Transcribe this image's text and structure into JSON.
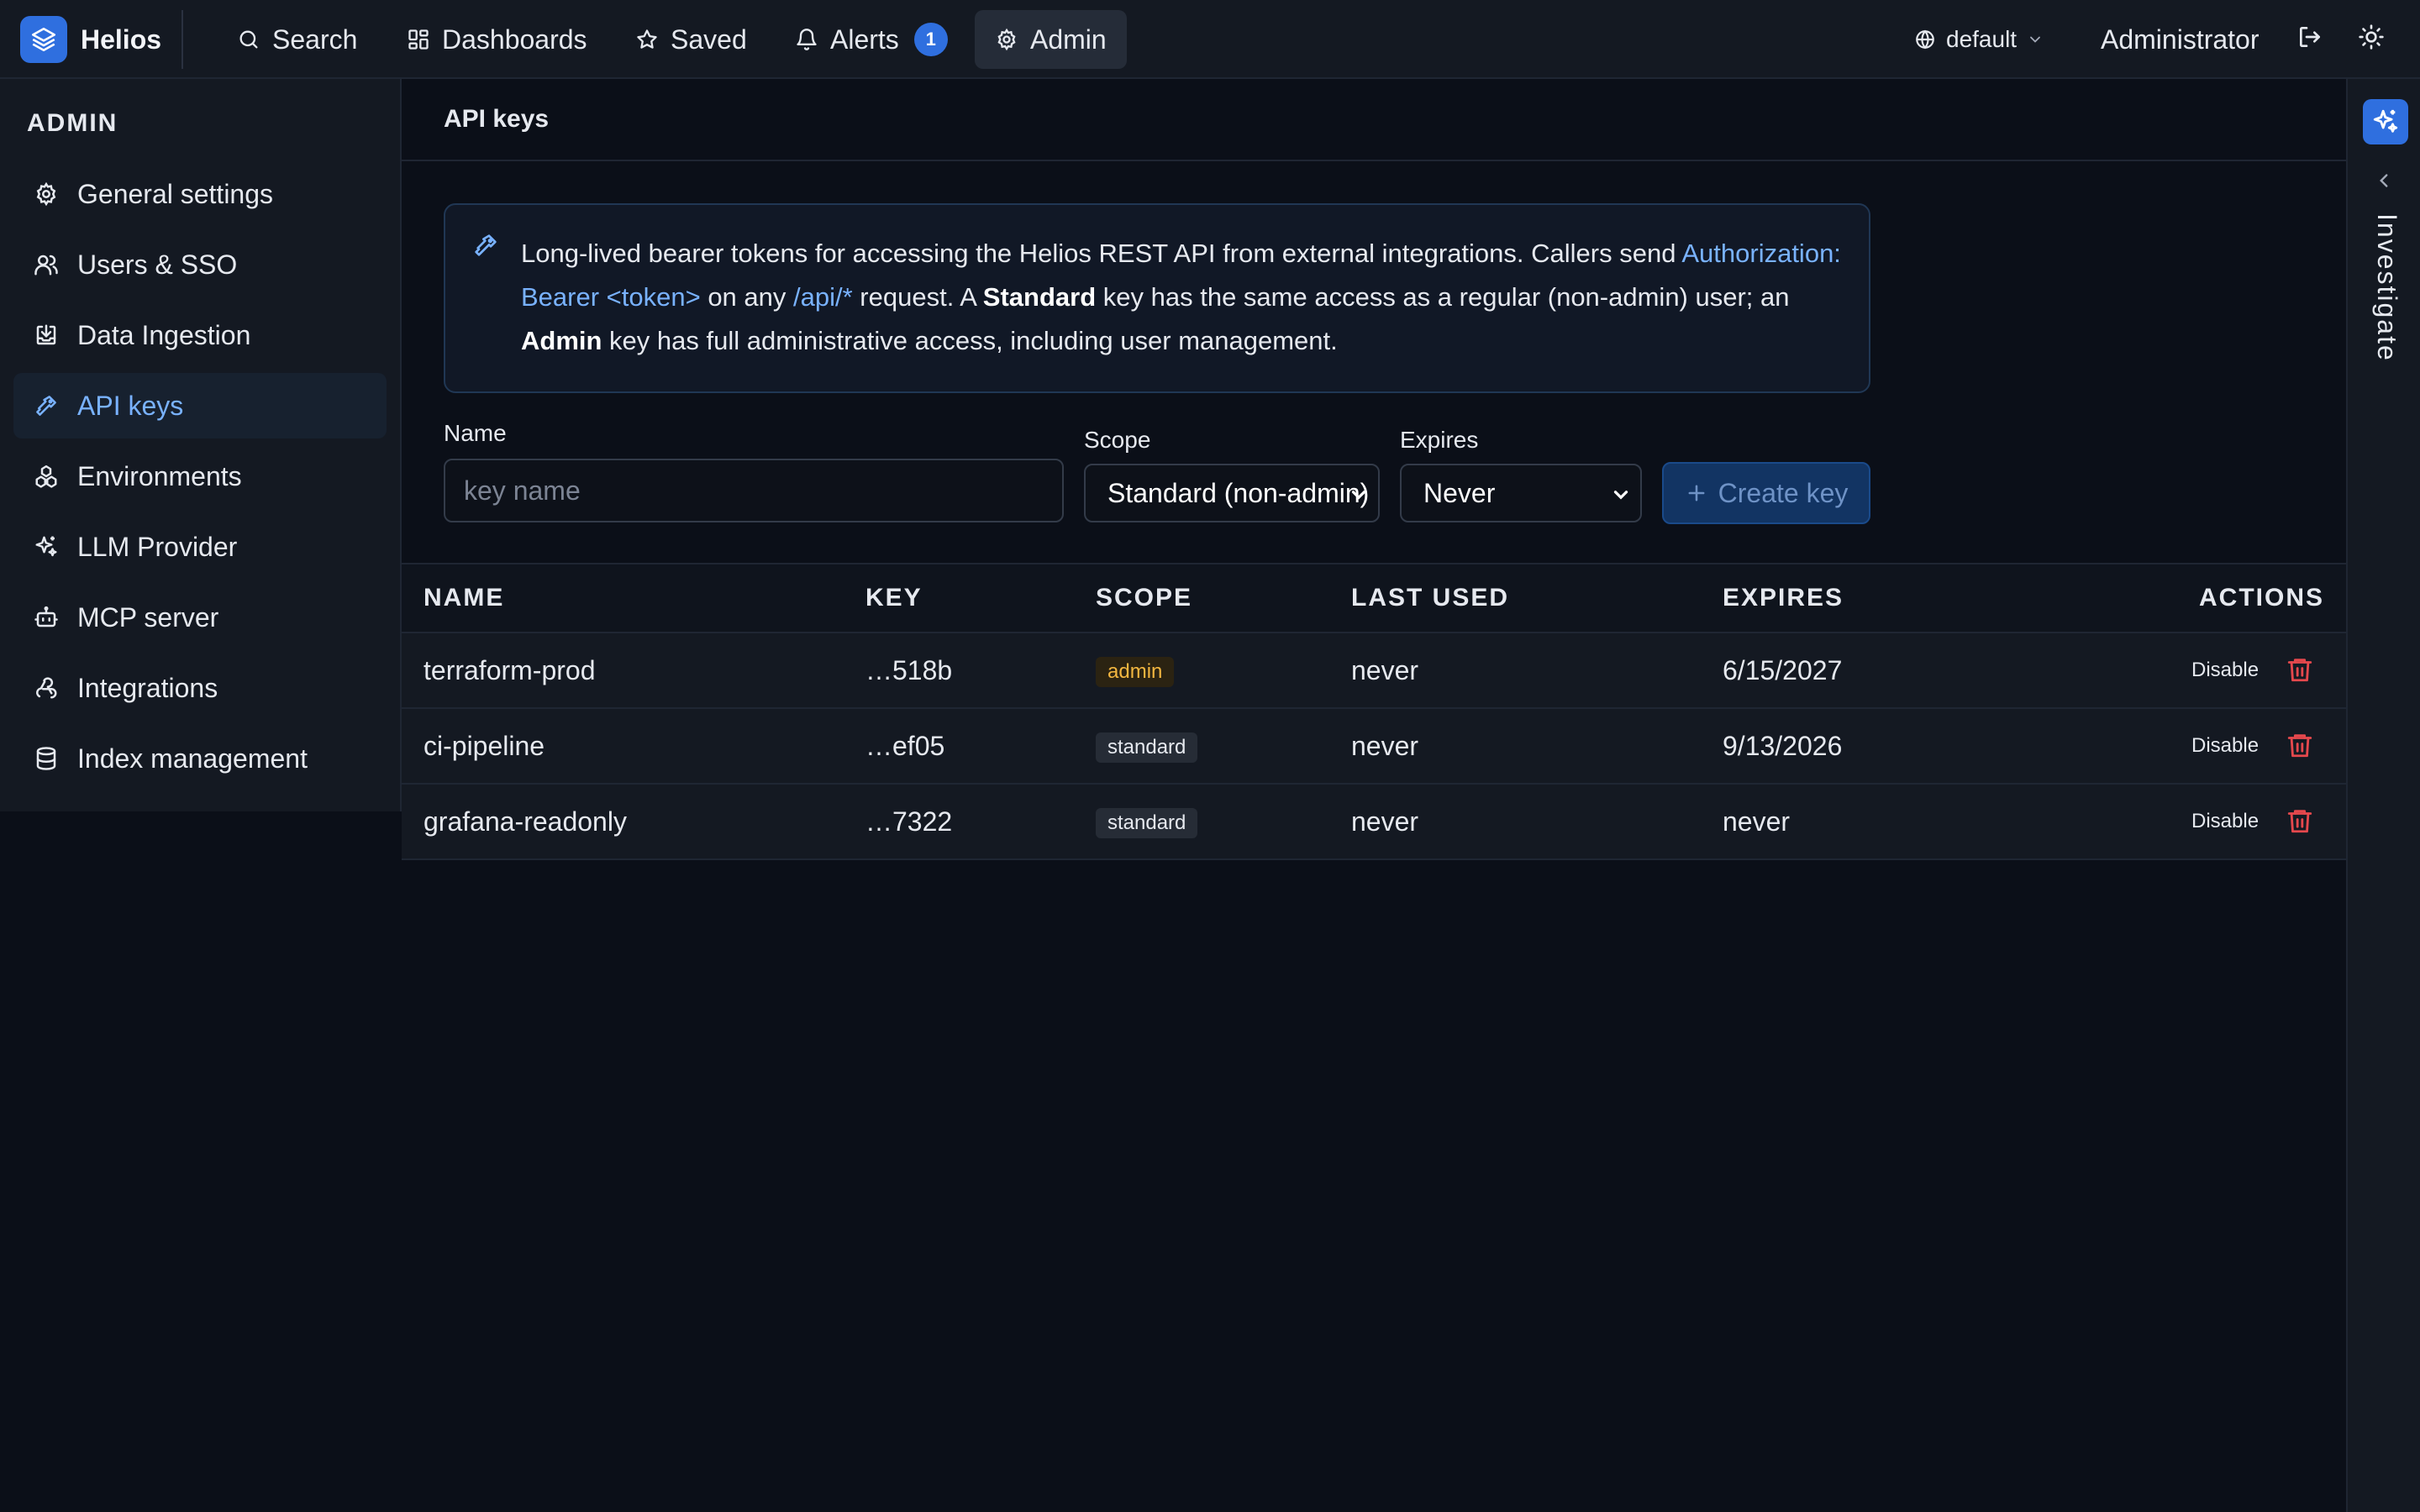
{
  "app": {
    "brand": "Helios"
  },
  "nav": {
    "search": "Search",
    "dashboards": "Dashboards",
    "saved": "Saved",
    "alerts": "Alerts",
    "alerts_count": "1",
    "admin": "Admin"
  },
  "header": {
    "environment": "default",
    "user": "Administrator"
  },
  "sidebar": {
    "heading": "ADMIN",
    "items": [
      {
        "label": "General settings",
        "icon": "gear-icon"
      },
      {
        "label": "Users & SSO",
        "icon": "users-icon"
      },
      {
        "label": "Data Ingestion",
        "icon": "inbox-download-icon"
      },
      {
        "label": "API keys",
        "icon": "key-icon",
        "active": true
      },
      {
        "label": "Environments",
        "icon": "boxes-icon"
      },
      {
        "label": "LLM Provider",
        "icon": "sparkles-icon"
      },
      {
        "label": "MCP server",
        "icon": "bot-icon"
      },
      {
        "label": "Integrations",
        "icon": "webhook-icon"
      },
      {
        "label": "Index management",
        "icon": "database-icon"
      }
    ]
  },
  "page": {
    "title": "API keys",
    "info": {
      "p1": "Long-lived bearer tokens for accessing the Helios REST API from external integrations. Callers send ",
      "code1": "Authorization: Bearer <token>",
      "p2": " on any ",
      "code2": "/api/*",
      "p3": " request. A ",
      "b1": "Standard",
      "p4": " key has the same access as a regular (non-admin) user; an ",
      "b2": "Admin",
      "p5": " key has full administrative access, including user management."
    }
  },
  "form": {
    "name_label": "Name",
    "name_placeholder": "key name",
    "scope_label": "Scope",
    "scope_value": "Standard (non-admin)",
    "expires_label": "Expires",
    "expires_value": "Never",
    "create_label": "Create key"
  },
  "table": {
    "columns": [
      "NAME",
      "KEY",
      "SCOPE",
      "LAST USED",
      "EXPIRES",
      "ACTIONS"
    ],
    "rows": [
      {
        "name": "terraform-prod",
        "key": "…518b",
        "scope": "admin",
        "last_used": "never",
        "expires": "6/15/2027",
        "action": "Disable"
      },
      {
        "name": "ci-pipeline",
        "key": "…ef05",
        "scope": "standard",
        "last_used": "never",
        "expires": "9/13/2026",
        "action": "Disable"
      },
      {
        "name": "grafana-readonly",
        "key": "…7322",
        "scope": "standard",
        "last_used": "never",
        "expires": "never",
        "action": "Disable"
      }
    ]
  },
  "rail": {
    "label": "Investigate"
  },
  "colors": {
    "accent": "#2f6fdf",
    "link": "#79b2ff",
    "admin_badge": "#f4b740",
    "danger": "#e5484d",
    "background": "#0b0f18",
    "panel": "#141922"
  }
}
